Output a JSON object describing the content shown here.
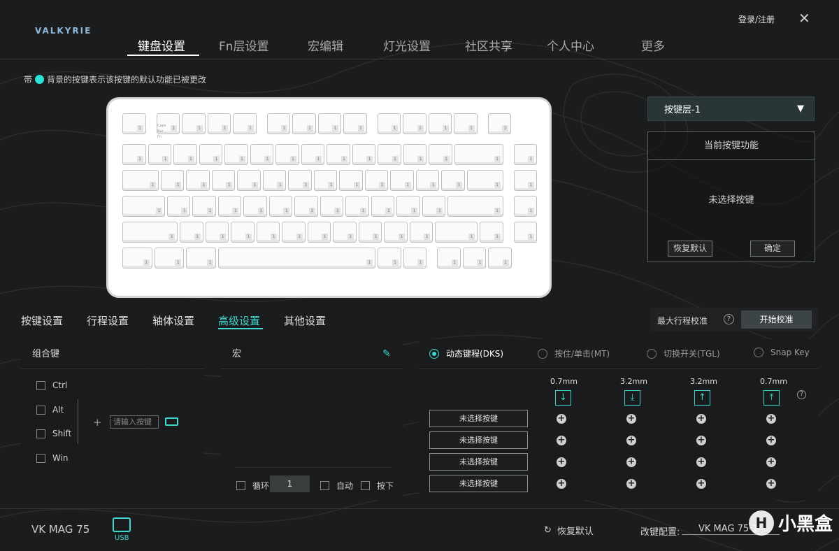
{
  "header": {
    "logo": "VALKYRIE",
    "login": "登录/注册",
    "close_glyph": "✕"
  },
  "nav": {
    "items": [
      {
        "label": "键盘设置",
        "active": true
      },
      {
        "label": "Fn层设置"
      },
      {
        "label": "宏编辑"
      },
      {
        "label": "灯光设置"
      },
      {
        "label": "社区共享"
      },
      {
        "label": "个人中心"
      },
      {
        "label": "更多"
      }
    ]
  },
  "hint": {
    "prefix": "带",
    "text": "背景的按键表示该按键的默认功能已被更改",
    "dot_color": "#2fe0d6"
  },
  "keyboard": {
    "key_label": "1",
    "leds": [
      "Caps",
      "Bar",
      "Fn"
    ]
  },
  "layer_select": {
    "value": "按键层-1",
    "arrow": "▼"
  },
  "func_panel": {
    "title": "当前按键功能",
    "empty": "未选择按键",
    "restore": "恢复默认",
    "confirm": "确定"
  },
  "tabs": {
    "items": [
      {
        "label": "按键设置"
      },
      {
        "label": "行程设置"
      },
      {
        "label": "轴体设置"
      },
      {
        "label": "高级设置",
        "active": true
      },
      {
        "label": "其他设置"
      }
    ]
  },
  "calibration": {
    "label": "最大行程校准",
    "help": "?",
    "button": "开始校准"
  },
  "combo": {
    "title": "组合键",
    "keys": [
      "Ctrl",
      "Alt",
      "Shift",
      "Win"
    ],
    "plus": "+",
    "input_placeholder": "请输入按键"
  },
  "macro": {
    "title": "宏",
    "loop_label": "循环",
    "loop_value": "1",
    "auto_label": "自动",
    "press_label": "按下"
  },
  "advanced": {
    "modes": [
      {
        "label": "动态键程(DKS)",
        "selected": true
      },
      {
        "label": "按住/单击(MT)"
      },
      {
        "label": "切换开关(TGL)"
      },
      {
        "label": "Snap Key"
      }
    ],
    "depths": [
      "0.7mm",
      "3.2mm",
      "3.2mm",
      "0.7mm"
    ],
    "help": "?",
    "unselected_key": "未选择按键",
    "action_plus": "+"
  },
  "footer": {
    "model": "VK MAG 75",
    "usb": "USB",
    "restore": "恢复默认",
    "restore_icon": "↻",
    "config_label": "改键配置:",
    "config_value": "VK MAG 75-1",
    "watermark": "小黑盒",
    "watermark_logo": "H"
  },
  "colors": {
    "accent": "#3fd8d0",
    "background": "#1b1c1d"
  }
}
